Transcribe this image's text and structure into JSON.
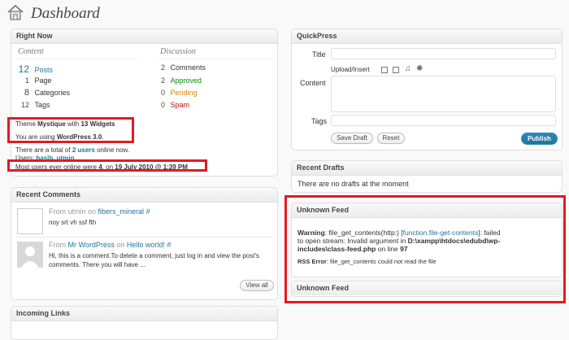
{
  "page": {
    "title": "Dashboard"
  },
  "right_now": {
    "title": "Right Now",
    "content_heading": "Content",
    "discussion_heading": "Discussion",
    "content": [
      {
        "count": "12",
        "label": "Posts"
      },
      {
        "count": "1",
        "label": "Page"
      },
      {
        "count": "8",
        "label": "Categories"
      },
      {
        "count": "12",
        "label": "Tags"
      }
    ],
    "discussion": [
      {
        "count": "2",
        "label": "Comments"
      },
      {
        "count": "2",
        "label": "Approved"
      },
      {
        "count": "0",
        "label": "Pending"
      },
      {
        "count": "0",
        "label": "Spam"
      }
    ],
    "theme_prefix": "Theme ",
    "theme_name": "Mystique",
    "theme_mid": " with ",
    "widgets": "13 Widgets",
    "version_prefix": "You are using ",
    "version": "WordPress 3.0",
    "version_suffix": ".",
    "online_prefix": "There are a total of ",
    "online_users": "2 users",
    "online_suffix": " online now.",
    "users_label": "Users: ",
    "users_list": "hasib, utmin",
    "most_prefix": "Most users ever online were ",
    "most_count": "4",
    "most_mid": ", on ",
    "most_date": "19 July 2010 @ 1:39 PM"
  },
  "recent_comments": {
    "title": "Recent Comments",
    "items": [
      {
        "from": "From utmin on ",
        "post": "fibers_mineral",
        "hash": " #",
        "text": "noy srt vh ssf fth"
      },
      {
        "from_prefix": "From ",
        "author": "Mr WordPress",
        "on": " on ",
        "post": "Hello world!",
        "hash": " #",
        "text1": "Hi, this is a comment.To delete a comment, just log in and view the post's",
        "text2": "comments. There you will have ..."
      }
    ],
    "view_all": "View all"
  },
  "incoming_links": {
    "title": "Incoming Links"
  },
  "quickpress": {
    "title": "QuickPress",
    "title_label": "Title",
    "upload_label": "Upload/Insert",
    "content_label": "Content",
    "tags_label": "Tags",
    "save_draft": "Save Draft",
    "reset": "Reset",
    "publish": "Publish"
  },
  "recent_drafts": {
    "title": "Recent Drafts",
    "message": "There are no drafts at the moment"
  },
  "unknown_feed_1": {
    "title": "Unknown Feed",
    "warning_label": "Warning",
    "warning_text1": ": file_get_contents(http:) [",
    "warning_link": "function.file-get-contents",
    "warning_text2": "]: failed",
    "warning_line2_a": "to open stream: Invalid argument in ",
    "warning_path1": "D:\\xampp\\htdocs\\edubd\\wp-",
    "warning_path2": "includes\\class-feed.php",
    "warning_on_line": " on line ",
    "warning_line_no": "97",
    "rss_label": "RSS Error",
    "rss_text": ": file_get_contents could not read the file"
  },
  "unknown_feed_2": {
    "title": "Unknown Feed"
  },
  "colors": {
    "highlight": "#e21a23",
    "link": "#21759b",
    "publish": "#21759b"
  }
}
